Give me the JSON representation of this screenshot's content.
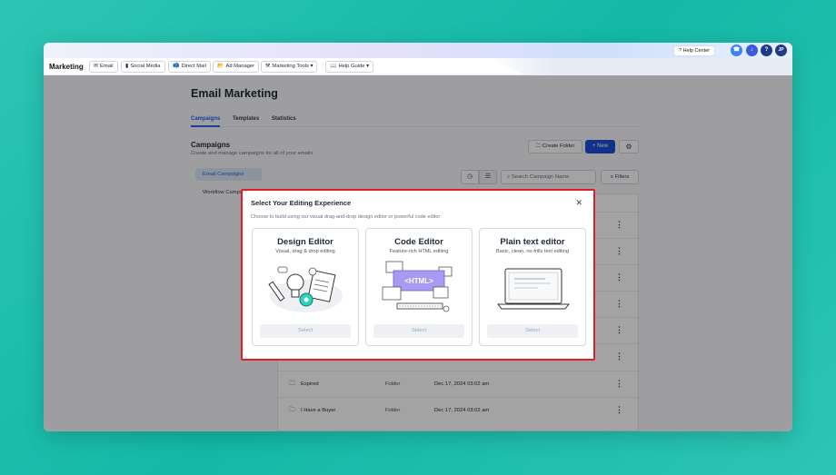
{
  "topbar": {
    "help_center": "? Help Center",
    "avatar_initials": "JP",
    "question_label": "?"
  },
  "navbar": {
    "app_title": "Marketing",
    "items": [
      {
        "icon": "✉",
        "label": "Email"
      },
      {
        "icon": "▮",
        "label": "Social Media"
      },
      {
        "icon": "📫",
        "label": "Direct Mail"
      },
      {
        "icon": "📂",
        "label": "Ad Manager"
      },
      {
        "icon": "⚒",
        "label": "Marketing Tools ▾"
      },
      {
        "icon": "📖",
        "label": "Help Guide ▾"
      }
    ]
  },
  "page": {
    "title": "Email Marketing",
    "tabs": [
      "Campaigns",
      "Templates",
      "Statistics"
    ],
    "section_title": "Campaigns",
    "section_subtitle": "Create and manage campaigns for all of your emails",
    "create_folder": "Create Folder",
    "new_button": "+ New",
    "search_placeholder": "Search Campaign Name",
    "filters": "Filters"
  },
  "sidebar": {
    "items": [
      "Email Campaigns",
      "Workflow Campaigns"
    ]
  },
  "table": {
    "rows": [
      {
        "name": "",
        "type": "",
        "date": ""
      },
      {
        "name": "",
        "type": "",
        "date": ""
      },
      {
        "name": "",
        "type": "",
        "date": ""
      },
      {
        "name": "",
        "type": "",
        "date": ""
      },
      {
        "name": "",
        "type": "",
        "date": ""
      },
      {
        "name": "",
        "type": "",
        "date": ""
      },
      {
        "name": "Expired",
        "type": "Folder",
        "date": "Dec 17, 2024 03:02 am"
      },
      {
        "name": "I Have a Buyer",
        "type": "Folder",
        "date": "Dec 17, 2024 03:02 am"
      }
    ]
  },
  "modal": {
    "title": "Select Your Editing Experience",
    "subtitle": "Choose to build using our visual drag-and-drop design editor or powerful code editor",
    "cards": [
      {
        "title": "Design Editor",
        "subtitle": "Visual, drag & drop editing",
        "select": "Select"
      },
      {
        "title": "Code Editor",
        "subtitle": "Feature-rich HTML editing",
        "select": "Select",
        "art_label": "<HTML>"
      },
      {
        "title": "Plain text editor",
        "subtitle": "Basic, clean, no-frills text editing",
        "select": "Select"
      }
    ]
  },
  "colors": {
    "accent": "#2563eb",
    "primary_button": "#1d4ed8",
    "highlight_border": "#e11d2a",
    "background": "#14b8a6"
  }
}
